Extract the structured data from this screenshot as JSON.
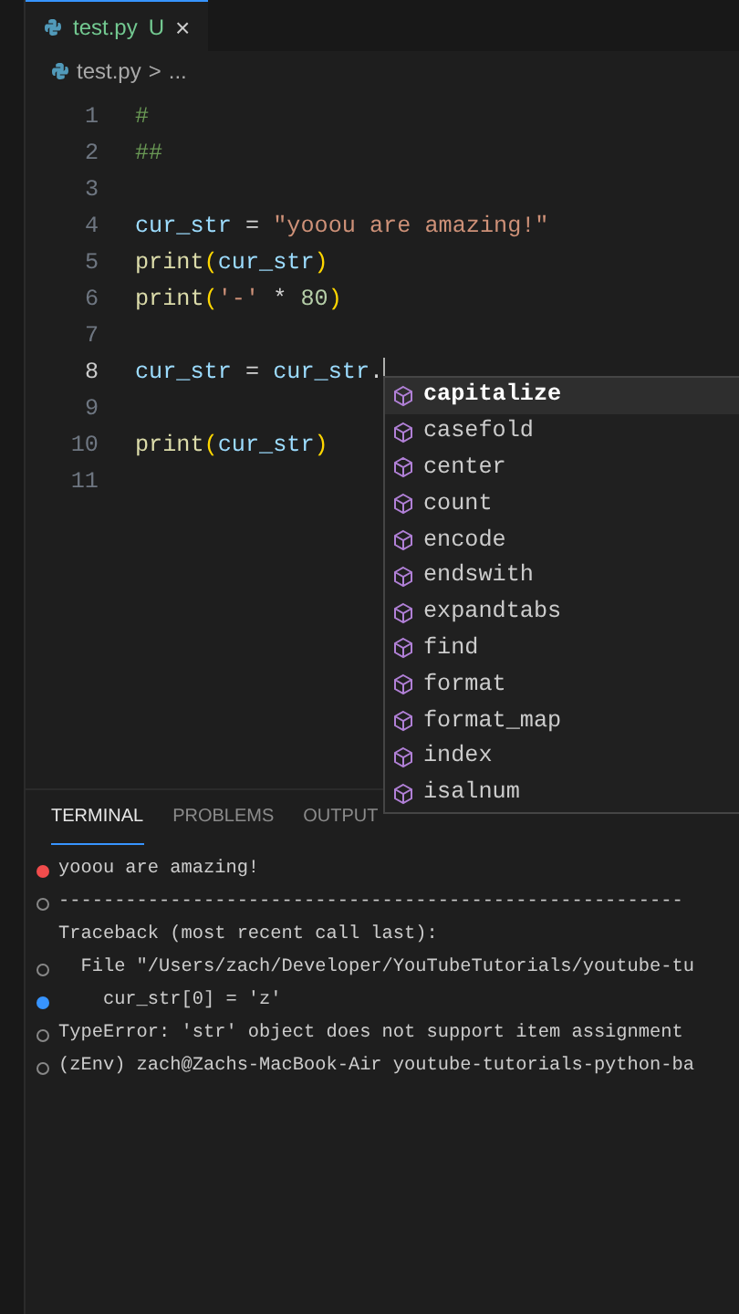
{
  "editor_tab": {
    "filename": "test.py",
    "status": "U",
    "close": "×",
    "selected": true
  },
  "breadcrumb": {
    "file": "test.py",
    "separator": ">",
    "more": "..."
  },
  "code_lines": [
    {
      "number": "1",
      "tokens": [
        {
          "text": "#",
          "kind": "comment"
        }
      ]
    },
    {
      "number": "2",
      "tokens": [
        {
          "text": "##",
          "kind": "comment"
        }
      ]
    },
    {
      "number": "3"
    },
    {
      "number": "4",
      "tokens": [
        {
          "text": "cur_str",
          "kind": "var"
        },
        {
          "text": " = ",
          "kind": "plain"
        },
        {
          "text": "\"yooou are amazing!\"",
          "kind": "string"
        }
      ]
    },
    {
      "number": "5",
      "tokens": [
        {
          "text": "print",
          "kind": "func"
        },
        {
          "text": "(",
          "kind": "paren"
        },
        {
          "text": "cur_str",
          "kind": "var"
        },
        {
          "text": ")",
          "kind": "paren"
        }
      ]
    },
    {
      "number": "6",
      "tokens": [
        {
          "text": "print",
          "kind": "func"
        },
        {
          "text": "(",
          "kind": "paren"
        },
        {
          "text": "'-'",
          "kind": "string"
        },
        {
          "text": " * ",
          "kind": "plain"
        },
        {
          "text": "80",
          "kind": "number"
        },
        {
          "text": ")",
          "kind": "paren"
        }
      ]
    },
    {
      "number": "7"
    },
    {
      "number": "8",
      "tokens": [
        {
          "text": "cur_str",
          "kind": "var"
        },
        {
          "text": " = ",
          "kind": "plain"
        },
        {
          "text": "cur_str",
          "kind": "var"
        },
        {
          "text": ".",
          "kind": "plain"
        }
      ],
      "current": true
    },
    {
      "number": "9"
    },
    {
      "number": "10",
      "tokens": [
        {
          "text": "print",
          "kind": "func"
        },
        {
          "text": "(",
          "kind": "paren"
        },
        {
          "text": "cur_str",
          "kind": "var"
        },
        {
          "text": ")",
          "kind": "paren"
        }
      ]
    },
    {
      "number": "11"
    }
  ],
  "suggestions": [
    {
      "label": "capitalize",
      "selected": true
    },
    {
      "label": "casefold",
      "selected": false
    },
    {
      "label": "center",
      "selected": false
    },
    {
      "label": "count",
      "selected": false
    },
    {
      "label": "encode",
      "selected": false
    },
    {
      "label": "endswith",
      "selected": false
    },
    {
      "label": "expandtabs",
      "selected": false
    },
    {
      "label": "find",
      "selected": false
    },
    {
      "label": "format",
      "selected": false
    },
    {
      "label": "format_map",
      "selected": false
    },
    {
      "label": "index",
      "selected": false
    },
    {
      "label": "isalnum",
      "selected": false
    }
  ],
  "panel_tabs": [
    {
      "label": "TERMINAL",
      "selected": true
    },
    {
      "label": "PROBLEMS",
      "selected": false
    },
    {
      "label": "OUTPUT",
      "selected": false
    }
  ],
  "terminal_lines": [
    {
      "text": "yooou are amazing!",
      "kind": "error"
    },
    {
      "text": "--------------------------------------------------------",
      "kind": "hollow"
    },
    {
      "text": "Traceback (most recent call last):",
      "kind": "none"
    },
    {
      "text": "  File \"/Users/zach/Developer/YouTubeTutorials/youtube-tu",
      "kind": "hollow"
    },
    {
      "text": "    cur_str[0] = 'z'",
      "kind": "blue"
    },
    {
      "text": "TypeError: 'str' object does not support item assignment",
      "kind": "hollow"
    },
    {
      "text": "(zEnv) zach@Zachs-MacBook-Air youtube-tutorials-python-ba",
      "kind": "hollow"
    }
  ]
}
